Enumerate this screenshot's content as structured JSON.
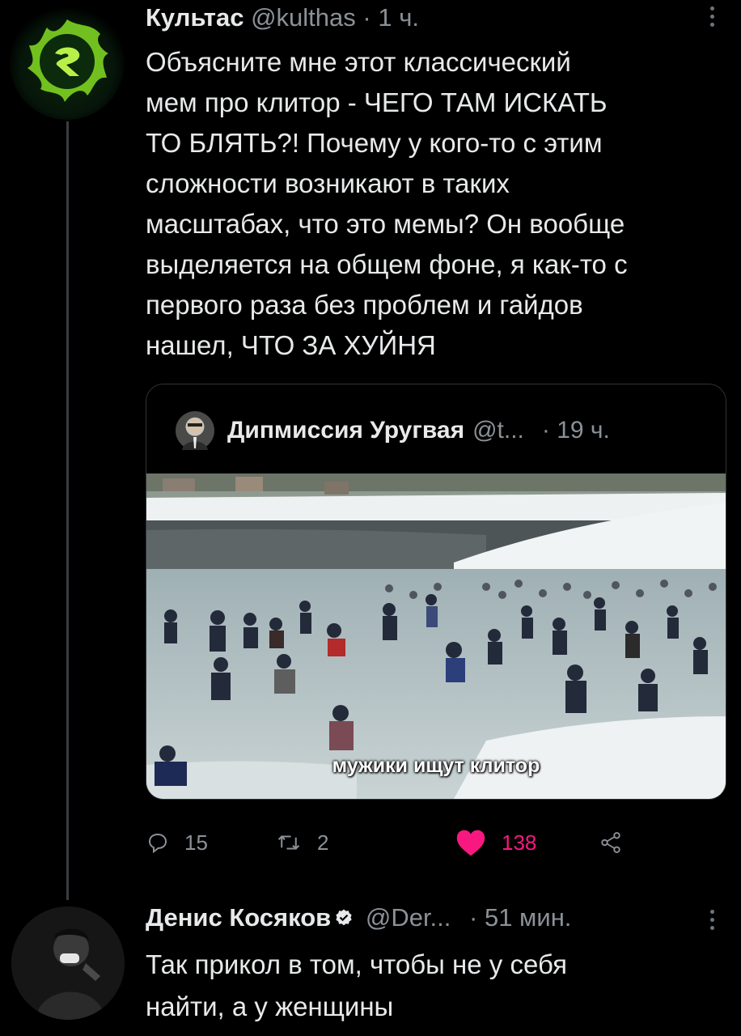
{
  "tweet1": {
    "display_name": "Культас",
    "handle": "@kulthas",
    "time": "· 1 ч.",
    "text": "Объясните мне этот классический\nмем про клитор - ЧЕГО ТАМ ИСКАТЬ\nТО БЛЯТЬ?! Почему у кого-то с этим\nсложности возникают в таких\nмасштабах, что это мемы? Он вообще\nвыделяется на общем фоне, я как-то с\nпервого раза без проблем и гайдов\nнашел, ЧТО ЗА ХУЙНЯ",
    "quote": {
      "display_name": "Дипмиссия Уругвая",
      "handle": "@t...",
      "time": "· 19 ч.",
      "image_caption": "мужики ищут клитор"
    },
    "actions": {
      "replies": "15",
      "retweets": "2",
      "likes": "138",
      "icons": [
        "reply-icon",
        "retweet-icon",
        "heart-icon",
        "share-icon"
      ]
    }
  },
  "tweet2": {
    "display_name": "Денис Косяков",
    "handle": "@Der...",
    "time": "· 51 мин.",
    "text": "Так прикол в том, чтобы не у себя\nнайти, а у женщины"
  },
  "colors": {
    "background": "#000000",
    "text": "#e7e9ea",
    "secondary": "#8b9197",
    "like": "#f91880",
    "verified": "#1d9bf0"
  }
}
